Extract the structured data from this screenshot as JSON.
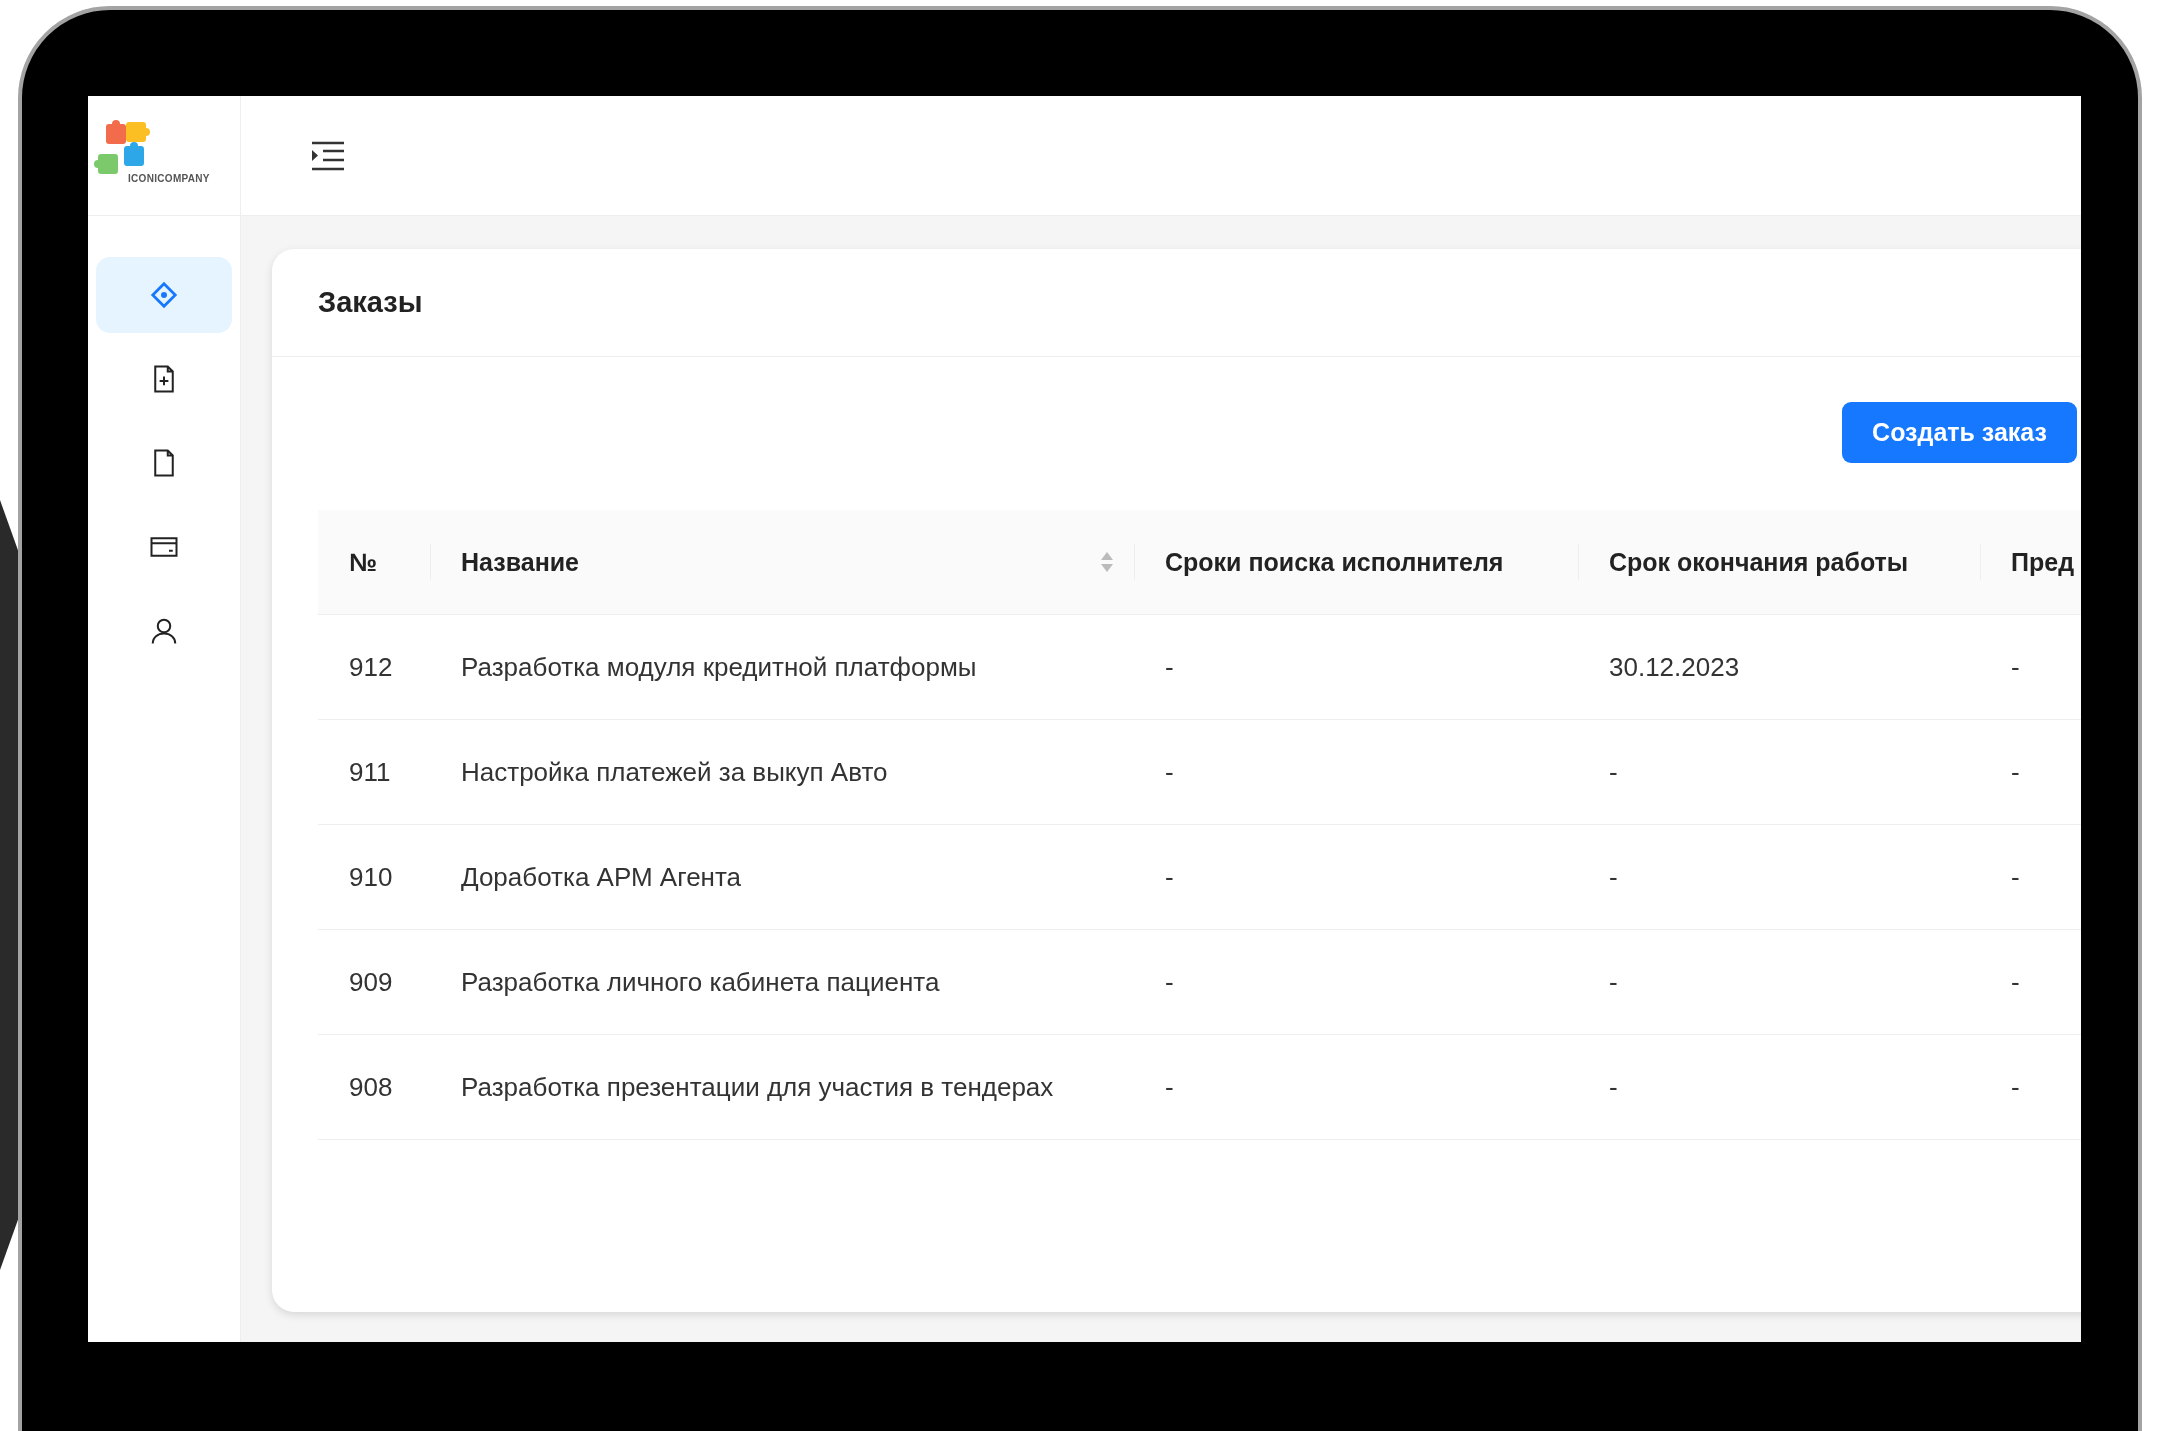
{
  "brand": {
    "logo_text": "ICONICOMPANY"
  },
  "sidebar": {
    "items": [
      {
        "kind": "diamond",
        "selected": true
      },
      {
        "kind": "file-add",
        "selected": false
      },
      {
        "kind": "file",
        "selected": false
      },
      {
        "kind": "card",
        "selected": false
      },
      {
        "kind": "user",
        "selected": false
      }
    ]
  },
  "page": {
    "title": "Заказы",
    "create_button": "Создать заказ"
  },
  "table": {
    "columns": [
      {
        "label": "№",
        "sortable": false
      },
      {
        "label": "Название",
        "sortable": true
      },
      {
        "label": "Сроки поиска исполнителя",
        "sortable": false
      },
      {
        "label": "Срок окончания работы",
        "sortable": false
      },
      {
        "label": "Пред",
        "sortable": false
      }
    ],
    "rows": [
      [
        "912",
        "Разработка модуля кредитной платформы",
        "-",
        "30.12.2023",
        "-"
      ],
      [
        "911",
        "Настройка платежей за выкуп Авто",
        "-",
        "-",
        "-"
      ],
      [
        "910",
        "Доработка АРМ Агента",
        "-",
        "-",
        "-"
      ],
      [
        "909",
        "Разработка личного кабинета пациента",
        "-",
        "-",
        "-"
      ],
      [
        "908",
        "Разработка презентации для участия в тендерах",
        "-",
        "-",
        "-"
      ]
    ]
  }
}
